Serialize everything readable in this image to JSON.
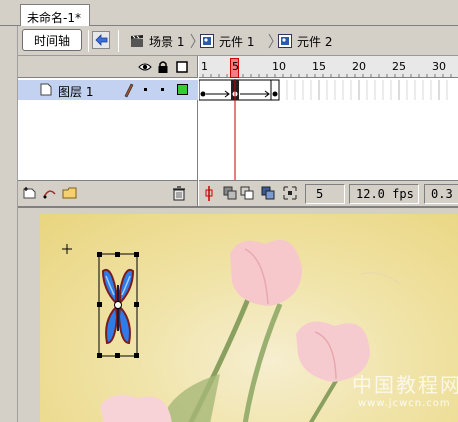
{
  "document": {
    "tab_title": "未命名-1*"
  },
  "editbar": {
    "timeline_button": "时间轴",
    "breadcrumbs": [
      "场景 1",
      "元件 1",
      "元件 2"
    ]
  },
  "timeline": {
    "layer_name": "图层 1",
    "ruler_numbers": [
      "1",
      "5",
      "10",
      "15",
      "20",
      "25",
      "30"
    ],
    "current_frame": "5",
    "frame_rate": "12.0 fps",
    "elapsed_time_partial": "0.3"
  },
  "stage": {
    "watermark_cn": "中国教程网",
    "watermark_url": "www.jcwcn.com"
  },
  "colors": {
    "layer_highlight": "#c2d2f0",
    "playhead": "#cc0000",
    "keyframe_green": "#33cc33",
    "butterfly_blue": "#2f7be8"
  }
}
